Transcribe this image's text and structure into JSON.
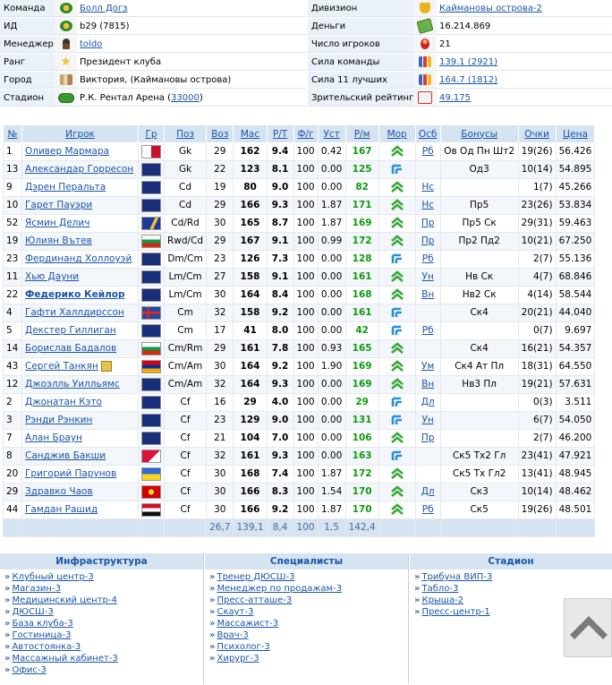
{
  "info": {
    "rows": [
      {
        "l_label": "Команда",
        "l_value": "Болл Догз",
        "l_link": true,
        "l_icon": "club-icon",
        "r_label": "Дивизион",
        "r_value": "Каймановы острова-2",
        "r_link": true,
        "r_icon": "trophy-icon"
      },
      {
        "l_label": "ИД",
        "l_value": "b29 (7815)",
        "l_link": false,
        "l_icon": "id-icon",
        "r_label": "Деньги",
        "r_value": "16.214.869",
        "r_link": false,
        "r_icon": "money-icon"
      },
      {
        "l_label": "Менеджер",
        "l_value": "toldo",
        "l_link": true,
        "l_icon": "manager-icon",
        "r_label": "Число игроков",
        "r_value": "21",
        "r_link": false,
        "r_icon": "players-icon"
      },
      {
        "l_label": "Ранг",
        "l_value": "Президент клуба",
        "l_link": false,
        "l_icon": "star-icon",
        "r_label": "Сила команды",
        "r_value": "139.1 (2921)",
        "r_link": true,
        "r_icon": "bar-chart-icon"
      },
      {
        "l_label": "Город",
        "l_value": "Виктория, (Каймановы острова)",
        "l_link": false,
        "l_icon": "city-icon",
        "r_label": "Сила 11 лучших",
        "r_value": "164.7 (1812)",
        "r_link": true,
        "r_icon": "bar-chart-icon"
      },
      {
        "l_label": "Стадион",
        "l_value": "Р.К. Рентал Арена (",
        "l_link2": "33000",
        "l_value_end": ")",
        "l_link": false,
        "l_icon": "stadium-icon",
        "r_label": "Зрительский рейтинг",
        "r_value": "49.175",
        "r_link": true,
        "r_icon": "rating-icon"
      }
    ]
  },
  "table": {
    "headers": [
      "№",
      "Игрок",
      "Гр",
      "Поз",
      "Воз",
      "Мас",
      "Р/Т",
      "Ф/г",
      "Уст",
      "Р/м",
      "Мор",
      "Осб",
      "Бонусы",
      "Очки",
      "Цена"
    ],
    "rows": [
      {
        "num": "1",
        "name": "Оливер Мармара",
        "flag": "malta",
        "pos": "Gk",
        "age": "29",
        "mas": "162",
        "rt": "9.4",
        "fg": "100",
        "ust": "0.42",
        "rm": "167",
        "mor": "up",
        "osb": "Рб",
        "bonus": "Ов Од Пн Шт2",
        "pts": "19(26)",
        "price": "56.426"
      },
      {
        "num": "13",
        "name": "Александар Горресон",
        "flag": "nz",
        "pos": "Gk",
        "age": "22",
        "mas": "123",
        "rt": "8.1",
        "fg": "100",
        "ust": "0.00",
        "rm": "125",
        "mor": "side",
        "osb": "",
        "bonus": "Од3",
        "pts": "10(14)",
        "price": "54.895"
      },
      {
        "num": "9",
        "name": "Дэрен Перальта",
        "flag": "cayman",
        "pos": "Cd",
        "age": "19",
        "mas": "80",
        "rt": "9.0",
        "fg": "100",
        "ust": "0.00",
        "rm": "82",
        "mor": "up",
        "osb": "Нс",
        "bonus": "",
        "pts": "1(7)",
        "price": "45.266"
      },
      {
        "num": "10",
        "name": "Гарет Пауэри",
        "flag": "cayman",
        "pos": "Cd",
        "age": "29",
        "mas": "166",
        "rt": "9.3",
        "fg": "100",
        "ust": "1.87",
        "rm": "171",
        "mor": "up",
        "osb": "Нс",
        "bonus": "Пр5",
        "pts": "23(26)",
        "price": "53.834"
      },
      {
        "num": "52",
        "name": "Ясмин Делич",
        "flag": "bosnia",
        "pos": "Cd/Rd",
        "age": "30",
        "mas": "165",
        "rt": "8.7",
        "fg": "100",
        "ust": "1.87",
        "rm": "169",
        "mor": "up",
        "osb": "Пр",
        "bonus": "Пр5 Ск",
        "pts": "29(31)",
        "price": "59.463"
      },
      {
        "num": "19",
        "name": "Юлиян Вътев",
        "flag": "bulgaria",
        "pos": "Rwd/Cd",
        "age": "29",
        "mas": "167",
        "rt": "9.1",
        "fg": "100",
        "ust": "0.99",
        "rm": "172",
        "mor": "up",
        "osb": "Пр",
        "bonus": "Пр2 Пд2",
        "pts": "10(21)",
        "price": "67.250"
      },
      {
        "num": "23",
        "name": "Фердинанд Холлоуэй",
        "flag": "cayman",
        "pos": "Dm/Cm",
        "age": "23",
        "mas": "126",
        "rt": "7.3",
        "fg": "100",
        "ust": "0.00",
        "rm": "128",
        "mor": "side",
        "osb": "Рб",
        "bonus": "",
        "pts": "2(7)",
        "price": "55.136"
      },
      {
        "num": "11",
        "name": "Хью Дауни",
        "flag": "cayman",
        "pos": "Lm/Cm",
        "age": "27",
        "mas": "158",
        "rt": "9.1",
        "fg": "100",
        "ust": "0.00",
        "rm": "161",
        "mor": "up",
        "osb": "Ун",
        "bonus": "Нв Ск",
        "pts": "4(7)",
        "price": "68.846"
      },
      {
        "num": "22",
        "name": "Федерико Кейлор",
        "bold": true,
        "flag": "nz",
        "pos": "Lm/Cm",
        "age": "30",
        "mas": "164",
        "rt": "8.4",
        "fg": "100",
        "ust": "0.00",
        "rm": "168",
        "mor": "up",
        "osb": "Вн",
        "bonus": "Нв2 Ск",
        "pts": "4(14)",
        "price": "58.544"
      },
      {
        "num": "4",
        "name": "Гафти Халлдирссон",
        "flag": "iceland",
        "pos": "Cm",
        "age": "32",
        "mas": "158",
        "rt": "9.2",
        "fg": "100",
        "ust": "0.00",
        "rm": "161",
        "mor": "side",
        "osb": "",
        "bonus": "Ск4",
        "pts": "20(21)",
        "price": "44.040"
      },
      {
        "num": "5",
        "name": "Декстер Гиллиган",
        "flag": "cayman",
        "pos": "Cm",
        "age": "17",
        "mas": "41",
        "rt": "8.0",
        "fg": "100",
        "ust": "0.00",
        "rm": "42",
        "mor": "side",
        "osb": "Рб",
        "bonus": "",
        "pts": "0(7)",
        "price": "9.697"
      },
      {
        "num": "14",
        "name": "Борислав Бадалов",
        "flag": "bulgaria",
        "pos": "Cm/Rm",
        "age": "29",
        "mas": "161",
        "rt": "7.8",
        "fg": "100",
        "ust": "0.93",
        "rm": "165",
        "mor": "up",
        "osb": "",
        "bonus": "Ск4",
        "pts": "16(21)",
        "price": "54.357"
      },
      {
        "num": "43",
        "name": "Сергей Танкян",
        "bonus_icon": true,
        "flag": "armenia",
        "pos": "Cm/Am",
        "age": "30",
        "mas": "164",
        "rt": "9.2",
        "fg": "100",
        "ust": "1.90",
        "rm": "169",
        "mor": "up",
        "osb": "Ум",
        "bonus": "Ск4 Ат Пл",
        "pts": "18(31)",
        "price": "64.550"
      },
      {
        "num": "12",
        "name": "Джоэлль Уилльямс",
        "flag": "cayman",
        "pos": "Cm/Am",
        "age": "32",
        "mas": "164",
        "rt": "9.3",
        "fg": "100",
        "ust": "0.00",
        "rm": "169",
        "mor": "up",
        "osb": "Вн",
        "bonus": "Нв3 Пл",
        "pts": "19(21)",
        "price": "57.631"
      },
      {
        "num": "2",
        "name": "Джонатан Кэто",
        "flag": "cayman",
        "pos": "Cf",
        "age": "16",
        "mas": "29",
        "rt": "4.0",
        "fg": "100",
        "ust": "0.00",
        "rm": "29",
        "mor": "side",
        "osb": "Дл",
        "bonus": "",
        "pts": "0(3)",
        "price": "3.511"
      },
      {
        "num": "3",
        "name": "Рэнди Рэнкин",
        "flag": "cayman",
        "pos": "Cf",
        "age": "23",
        "mas": "129",
        "rt": "9.0",
        "fg": "100",
        "ust": "0.00",
        "rm": "131",
        "mor": "side",
        "osb": "Ун",
        "bonus": "",
        "pts": "6(7)",
        "price": "54.050"
      },
      {
        "num": "7",
        "name": "Алан Браун",
        "flag": "cayman",
        "pos": "Cf",
        "age": "21",
        "mas": "104",
        "rt": "7.0",
        "fg": "100",
        "ust": "0.00",
        "rm": "106",
        "mor": "up",
        "osb": "Пр",
        "bonus": "",
        "pts": "2(7)",
        "price": "46.200"
      },
      {
        "num": "8",
        "name": "Санджив Бакши",
        "flag": "nepal",
        "pos": "Cf",
        "age": "32",
        "mas": "161",
        "rt": "9.3",
        "fg": "100",
        "ust": "0.00",
        "rm": "163",
        "mor": "side",
        "osb": "",
        "bonus": "Ск5 Тх2 Гл",
        "pts": "23(41)",
        "price": "47.921"
      },
      {
        "num": "20",
        "name": "Григорий Парунов",
        "flag": "ukraine",
        "pos": "Cf",
        "age": "30",
        "mas": "168",
        "rt": "7.4",
        "fg": "100",
        "ust": "1.87",
        "rm": "172",
        "mor": "up",
        "osb": "",
        "bonus": "Ск5 Тх Гл2",
        "pts": "13(41)",
        "price": "48.945"
      },
      {
        "num": "29",
        "name": "Здравко Чаов",
        "flag": "macedonia",
        "pos": "Cf",
        "age": "30",
        "mas": "166",
        "rt": "8.3",
        "fg": "100",
        "ust": "1.54",
        "rm": "170",
        "mor": "up",
        "osb": "Дл",
        "bonus": "Ск3",
        "pts": "10(14)",
        "price": "48.462"
      },
      {
        "num": "44",
        "name": "Гамдан Рашид",
        "flag": "egypt",
        "pos": "Cf",
        "age": "30",
        "mas": "166",
        "rt": "9.2",
        "fg": "100",
        "ust": "1.87",
        "rm": "170",
        "mor": "up",
        "osb": "Рб",
        "bonus": "Ск5",
        "pts": "19(26)",
        "price": "48.501"
      }
    ],
    "footer": {
      "age": "26,7",
      "mas": "139,1",
      "rt": "8,4",
      "fg": "100",
      "ust": "1,5",
      "rm": "142,4"
    }
  },
  "bottom": {
    "infra": {
      "title": "Инфраструктура",
      "items": [
        "Клубный центр-3",
        "Магазин-3",
        "Медицинский центр-4",
        "ДЮСШ-3",
        "База клуба-3",
        "Гостиница-3",
        "Автостоянка-3",
        "Массажный кабинет-3",
        "Офис-3"
      ]
    },
    "spec": {
      "title": "Специалисты",
      "items": [
        "Тренер ДЮСШ-3",
        "Менеджер по продажам-3",
        "Пресс-атташе-3",
        "Скаут-3",
        "Массажист-3",
        "Врач-3",
        "Психолог-3",
        "Хирург-3"
      ]
    },
    "stadium": {
      "title": "Стадион",
      "items": [
        "Трибуна ВИП-3",
        "Табло-3",
        "Крыша-2",
        "Пресс-центр-1"
      ]
    }
  },
  "colors": {
    "header_bg": "#d6e4f2",
    "link": "#1a55a8",
    "green": "#119a11",
    "label_bg": "#eaf1f8"
  }
}
